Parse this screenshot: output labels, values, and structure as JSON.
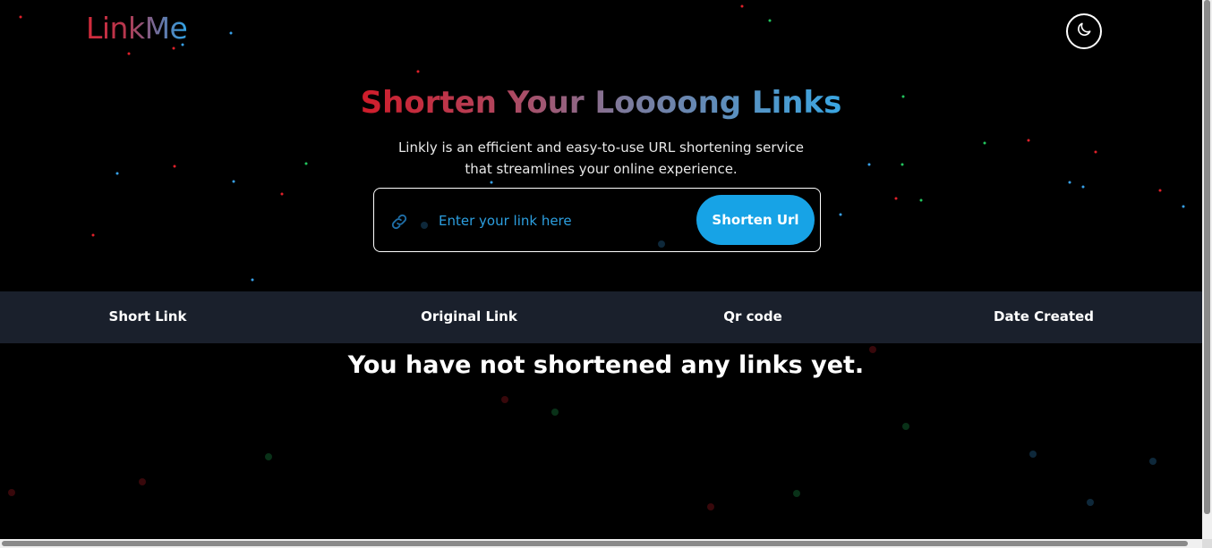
{
  "header": {
    "logo": "LinkMe",
    "theme_toggle_icon": "moon-icon"
  },
  "hero": {
    "title": "Shorten Your Loooong Links",
    "subtitle": "Linkly is an efficient and easy-to-use URL shortening service that streamlines your online experience."
  },
  "form": {
    "link_icon": "link-icon",
    "input_placeholder": "Enter your link here",
    "input_value": "",
    "button_label": "Shorten Url"
  },
  "table": {
    "headers": [
      "Short Link",
      "Original Link",
      "Qr code",
      "Date Created"
    ],
    "empty_message": "You have not shortened any links yet."
  },
  "colors": {
    "background": "#000000",
    "accent": "#17a3e6",
    "header_row": "#1a202c",
    "gradient_start": "#d01c2a",
    "gradient_end": "#3aa6e2",
    "star_red": "#e0202a",
    "star_green": "#22c55e",
    "star_blue": "#38a0e8"
  }
}
